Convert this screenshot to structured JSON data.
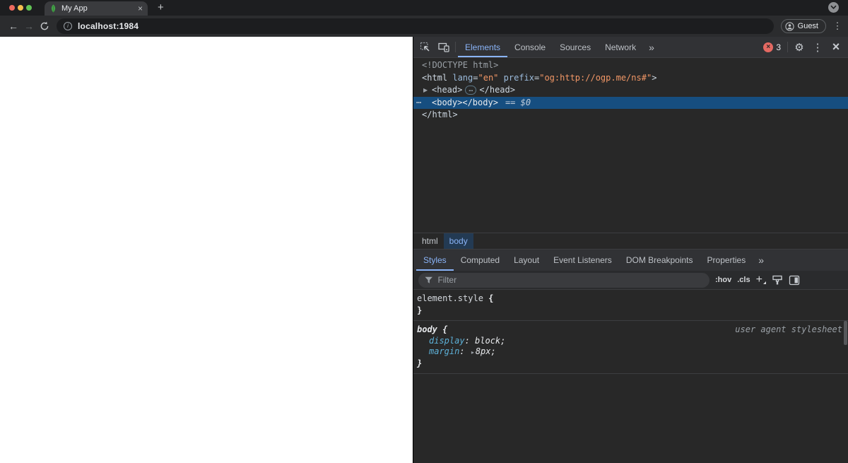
{
  "colors": {
    "traffic_red": "#ee6a5f",
    "traffic_yellow": "#f5bf4f",
    "traffic_green": "#61c455",
    "accent_blue": "#8ab4f8",
    "selection_blue": "#164e80",
    "tag_color": "#ccd6e0",
    "attr_name_color": "#9bbbdc",
    "attr_value_color": "#f29766",
    "property_name_color": "#5db0d7",
    "error_red": "#e46962",
    "favicon_green": "#43a047"
  },
  "glyphs": {
    "close": "×",
    "plus": "+",
    "kebab": "⋮",
    "back": "←",
    "forward": "→",
    "more": "»",
    "expander": "▶",
    "expander_small": "▸",
    "ellipsis": "…",
    "gutter_dots": "…",
    "info": "i",
    "gear": "⚙"
  },
  "browser": {
    "tab": {
      "title": "My App"
    },
    "address": {
      "url": "localhost:1984"
    },
    "profile_label": "Guest"
  },
  "devtools": {
    "tabs": [
      {
        "label": "Elements",
        "active": true
      },
      {
        "label": "Console",
        "active": false
      },
      {
        "label": "Sources",
        "active": false
      },
      {
        "label": "Network",
        "active": false
      }
    ],
    "error_count": "3",
    "dom": {
      "doctype": "<!DOCTYPE html>",
      "html_open": {
        "pre": "<html ",
        "attr1_name": "lang",
        "eq1": "=",
        "attr1_value": "\"en\"",
        "attr2_name": "prefix",
        "eq2": "=",
        "attr2_value": "\"og:http://ogp.me/ns#\"",
        "post": ">"
      },
      "head": {
        "open": "<head>",
        "collapsed": "…",
        "close": "</head>"
      },
      "body": {
        "open": "<body>",
        "close": "</body>",
        "selected_hint": "== $0"
      },
      "html_close": "</html>"
    },
    "crumbs": [
      {
        "label": "html",
        "selected": false
      },
      {
        "label": "body",
        "selected": true
      }
    ],
    "sidebar_tabs": [
      {
        "label": "Styles",
        "active": true
      },
      {
        "label": "Computed",
        "active": false
      },
      {
        "label": "Layout",
        "active": false
      },
      {
        "label": "Event Listeners",
        "active": false
      },
      {
        "label": "DOM Breakpoints",
        "active": false
      },
      {
        "label": "Properties",
        "active": false
      }
    ],
    "styles": {
      "filter": {
        "placeholder": "Filter"
      },
      "toggles": {
        "hov": ":hov",
        "cls": ".cls"
      },
      "element_style": {
        "selector": "element.style",
        "brace_open": "{",
        "brace_close": "}"
      },
      "body_rule": {
        "selector": "body",
        "brace_open": "{",
        "brace_close": "}",
        "origin": "user agent stylesheet",
        "properties": [
          {
            "name": "display",
            "value": "block;"
          },
          {
            "name": "margin",
            "value": "8px;"
          }
        ]
      }
    }
  }
}
